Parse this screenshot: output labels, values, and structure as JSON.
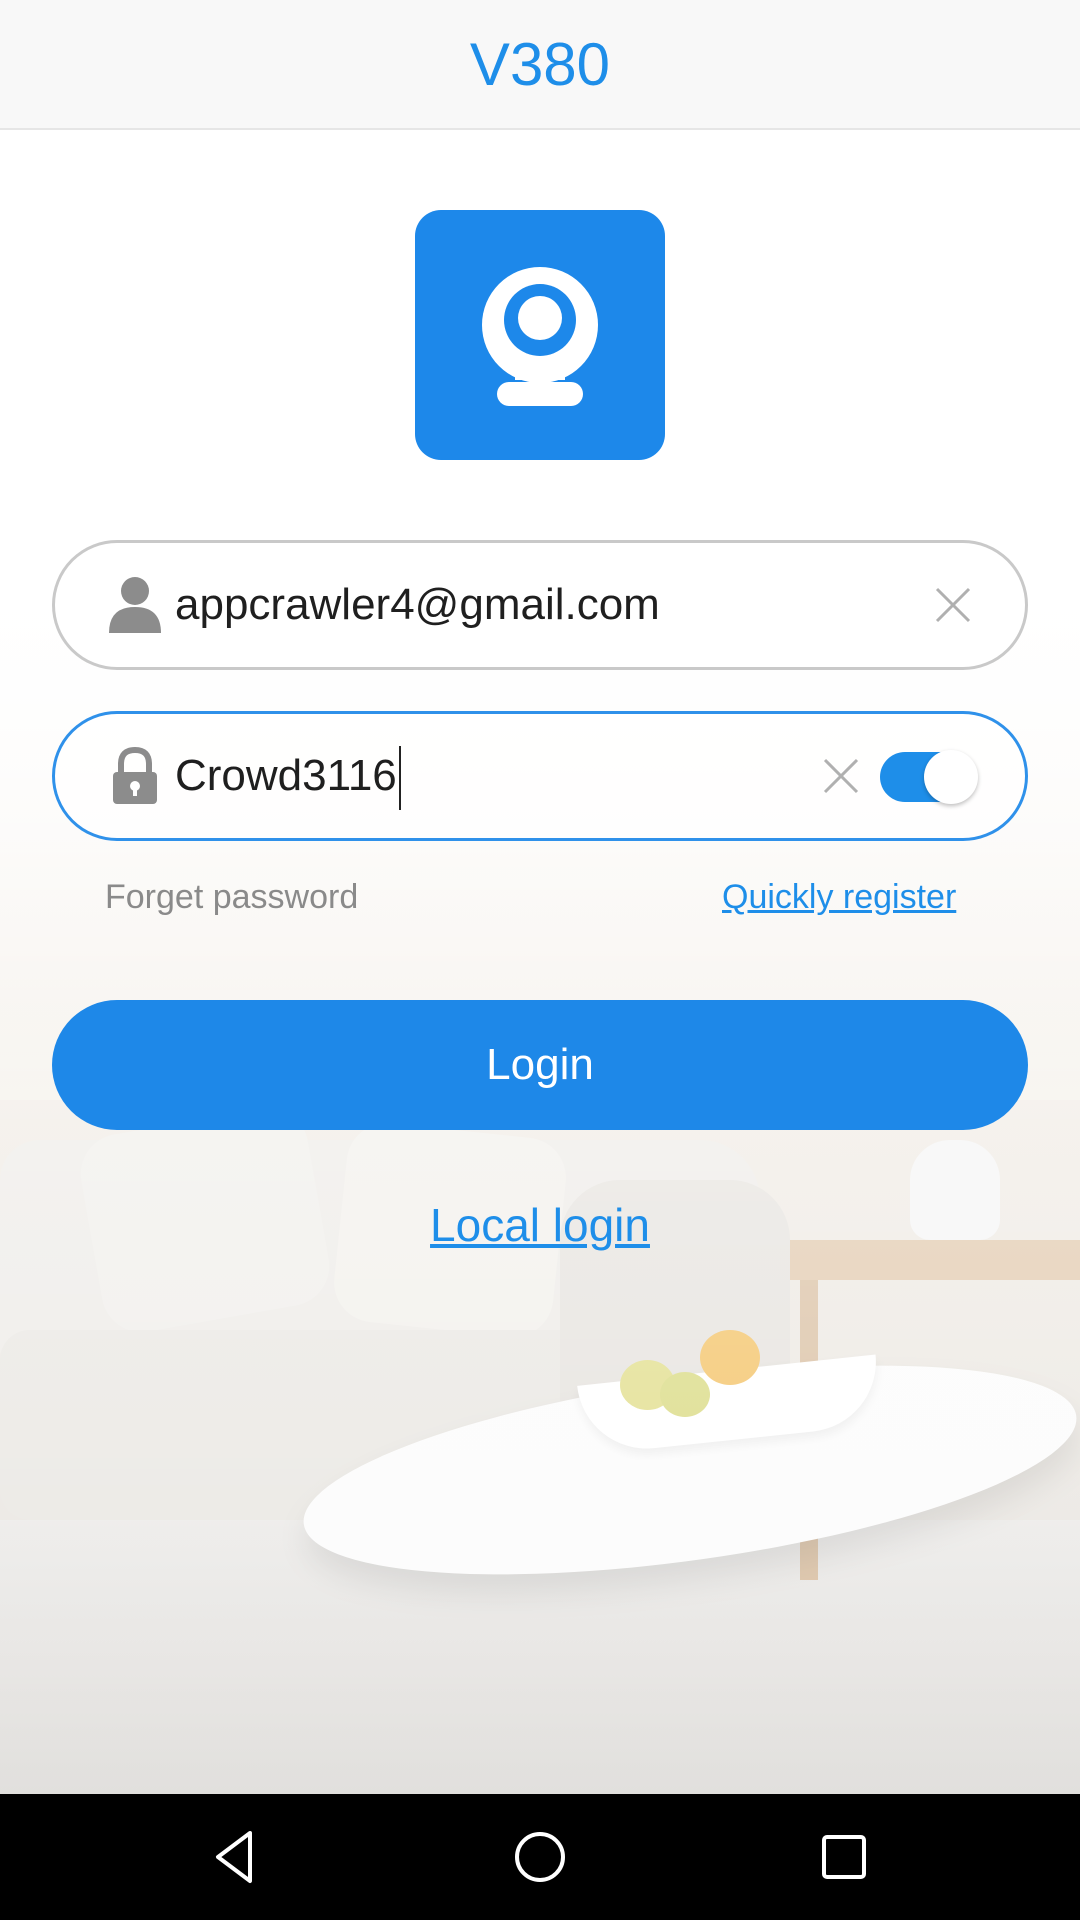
{
  "app": {
    "title": "V380"
  },
  "login_form": {
    "username": {
      "value": "appcrawler4@gmail.com",
      "icon": "user-icon",
      "clear_icon": "clear-icon"
    },
    "password": {
      "value": "Crowd3116",
      "icon": "lock-icon",
      "clear_icon": "clear-icon",
      "show_password_toggle": "on"
    },
    "forget_password_label": "Forget password",
    "register_label": "Quickly register",
    "login_button_label": "Login",
    "local_login_label": "Local login"
  },
  "nav_bar": {
    "back_icon": "back-triangle-icon",
    "home_icon": "home-circle-icon",
    "recent_icon": "recent-square-icon"
  },
  "colors": {
    "accent": "#1e8ee9",
    "button": "#1e88e8",
    "logo": "#1d88ea"
  }
}
